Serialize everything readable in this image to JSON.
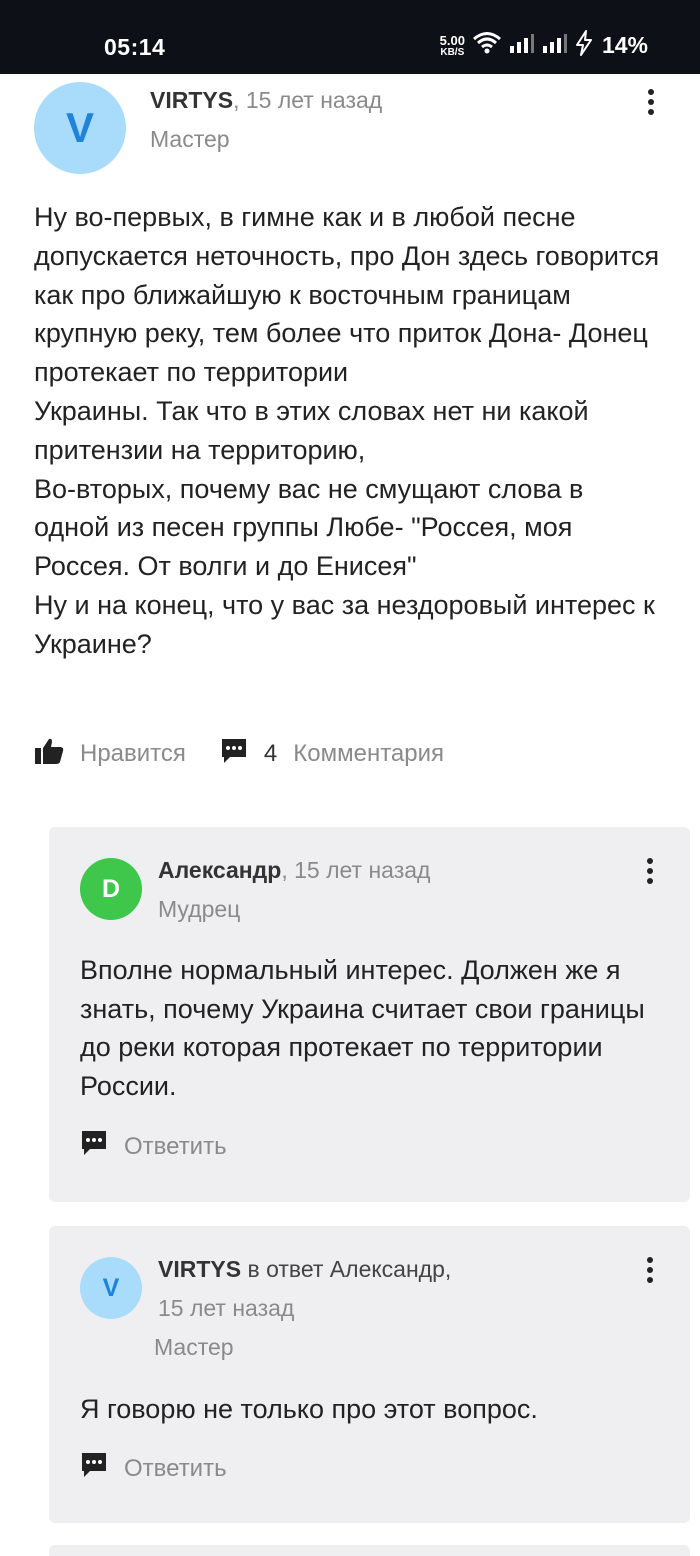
{
  "status_bar": {
    "time": "05:14",
    "net_speed_value": "5.00",
    "net_speed_unit": "KB/S",
    "battery": "14%"
  },
  "post": {
    "avatar_letter": "V",
    "author": "VIRTYS",
    "time_sep": ", 15 лет назад",
    "rank": "Мастер",
    "body": "Ну во-первых, в гимне как и в любой песне допускается неточность, про Дон здесь говорится как про ближайшую к восточным границам крупную реку, тем более что приток Дона- Донец протекает по территории\nУкраины. Так что в этих словах нет ни какой притензии на территорию,\nВо-вторых, почему вас не смущают слова в одной из песен группы Любе- \"Россея, моя Россея. От волги и до Енисея\"\nНу и на конец, что у вас за нездоровый интерес к Украине?",
    "like_label": "Нравится",
    "comments_count": "4",
    "comments_label": "Комментария"
  },
  "replies": [
    {
      "avatar_letter": "D",
      "author": "Александр",
      "time_sep": ", 15 лет назад",
      "rank": "Мудрец",
      "text": "Вполне нормальный интерес. Должен же я знать, почему Украина считает свои границы до реки которая протекает по территории России.",
      "reply_label": "Ответить"
    },
    {
      "avatar_letter": "V",
      "author": "VIRTYS",
      "reply_to": " в ответ Александр,",
      "time": "15 лет назад",
      "rank": "Мастер",
      "text": "Я говорю не только про этот вопрос.",
      "reply_label": "Ответить"
    }
  ],
  "colors": {
    "status_bar_bg": "#0d1117",
    "avatar_v_bg": "#a9dcfb",
    "avatar_v_fg": "#1f83d9",
    "avatar_d_bg": "#3ec74a",
    "reply_bg": "#efeff1",
    "muted_text": "#8a8a8a"
  }
}
